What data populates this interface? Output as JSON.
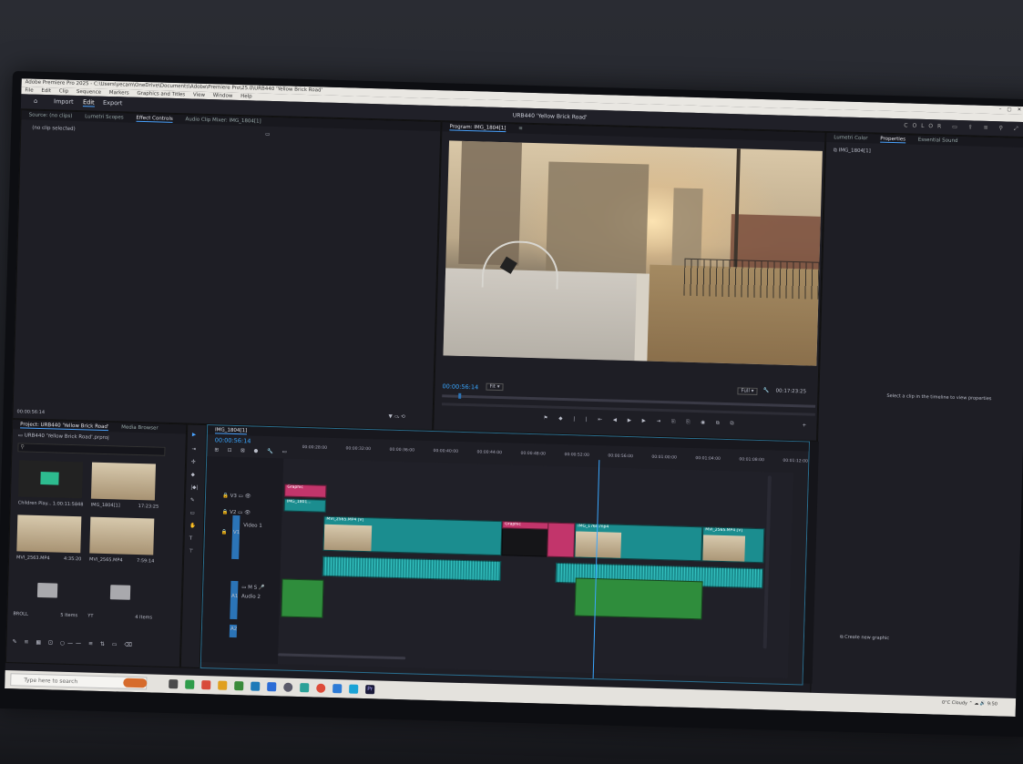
{
  "app": {
    "title": "Adobe Premiere Pro 2025 - C:\\Users\\yecam\\OneDrive\\Documents\\Adobe\\Premiere Pro\\25.0\\URB440 'Yellow Brick Road'",
    "menu": [
      "File",
      "Edit",
      "Clip",
      "Sequence",
      "Markers",
      "Graphics and Titles",
      "View",
      "Window",
      "Help"
    ],
    "workspaces": [
      "Import",
      "Edit",
      "Export"
    ],
    "project_title": "URB440 'Yellow Brick Road'",
    "right_label": "COLOR"
  },
  "source_panel": {
    "tabs": [
      "Source: (no clips)",
      "Lumetri Scopes",
      "Effect Controls",
      "Audio Clip Mixer: IMG_1804[1]"
    ],
    "no_clip": "(no clip selected)",
    "timecode": "00:00:56:14"
  },
  "program_panel": {
    "tab": "Program: IMG_1804[1]",
    "timecode": "00:00:56:14",
    "fit": "Fit",
    "quality": "Full",
    "duration": "00:17:23:25"
  },
  "right_panel": {
    "tabs": [
      "Lumetri Color",
      "Properties",
      "Essential Sound"
    ],
    "clip_name": "IMG_1804[1]",
    "hint": "Select a clip in the timeline to view properties",
    "button": "Create new graphic"
  },
  "project_panel": {
    "tabs": [
      "Project: URB440 'Yellow Brick Road'",
      "Media Browser"
    ],
    "project_file": "URB440 'Yellow Brick Road'.prproj",
    "items": [
      {
        "name": "Children Play...",
        "dur": "1:00:11:5848"
      },
      {
        "name": "IMG_1804[1]",
        "dur": "17:23:25"
      },
      {
        "name": "MVI_2563.MP4",
        "dur": "4:35:20"
      },
      {
        "name": "MVI_2565.MP4",
        "dur": "7:59:14"
      }
    ],
    "bins": [
      {
        "name": "BROLL",
        "count": "5 Items"
      },
      {
        "name": "YT",
        "count": "4 Items"
      }
    ]
  },
  "timeline": {
    "tab": "IMG_1804[1]",
    "timecode": "00:00:56:14",
    "ruler": [
      "00:00:28:00",
      "00:00:32:00",
      "00:00:36:00",
      "00:00:40:00",
      "00:00:44:00",
      "00:00:48:00",
      "00:00:52:00",
      "00:00:56:00",
      "00:01:00:00",
      "00:01:04:00",
      "00:01:08:00",
      "00:01:12:00"
    ],
    "tracks": [
      "V3",
      "V2",
      "V1",
      "A1",
      "A2",
      "A3"
    ],
    "video1_label": "Video 1",
    "audio2_label": "Audio 2",
    "clips": {
      "graphic1": "Graphic",
      "img1": "IMG_1801...",
      "mvi": "MVI_2565.MP4 [V]",
      "graphic2": "Graphic",
      "img2": "IMG_1760.mp4",
      "mvi2": "MVI_2565.MP4 [V]"
    }
  },
  "taskbar": {
    "search_placeholder": "Type here to search",
    "weather": "0°C Cloudy",
    "time": "9:50"
  }
}
